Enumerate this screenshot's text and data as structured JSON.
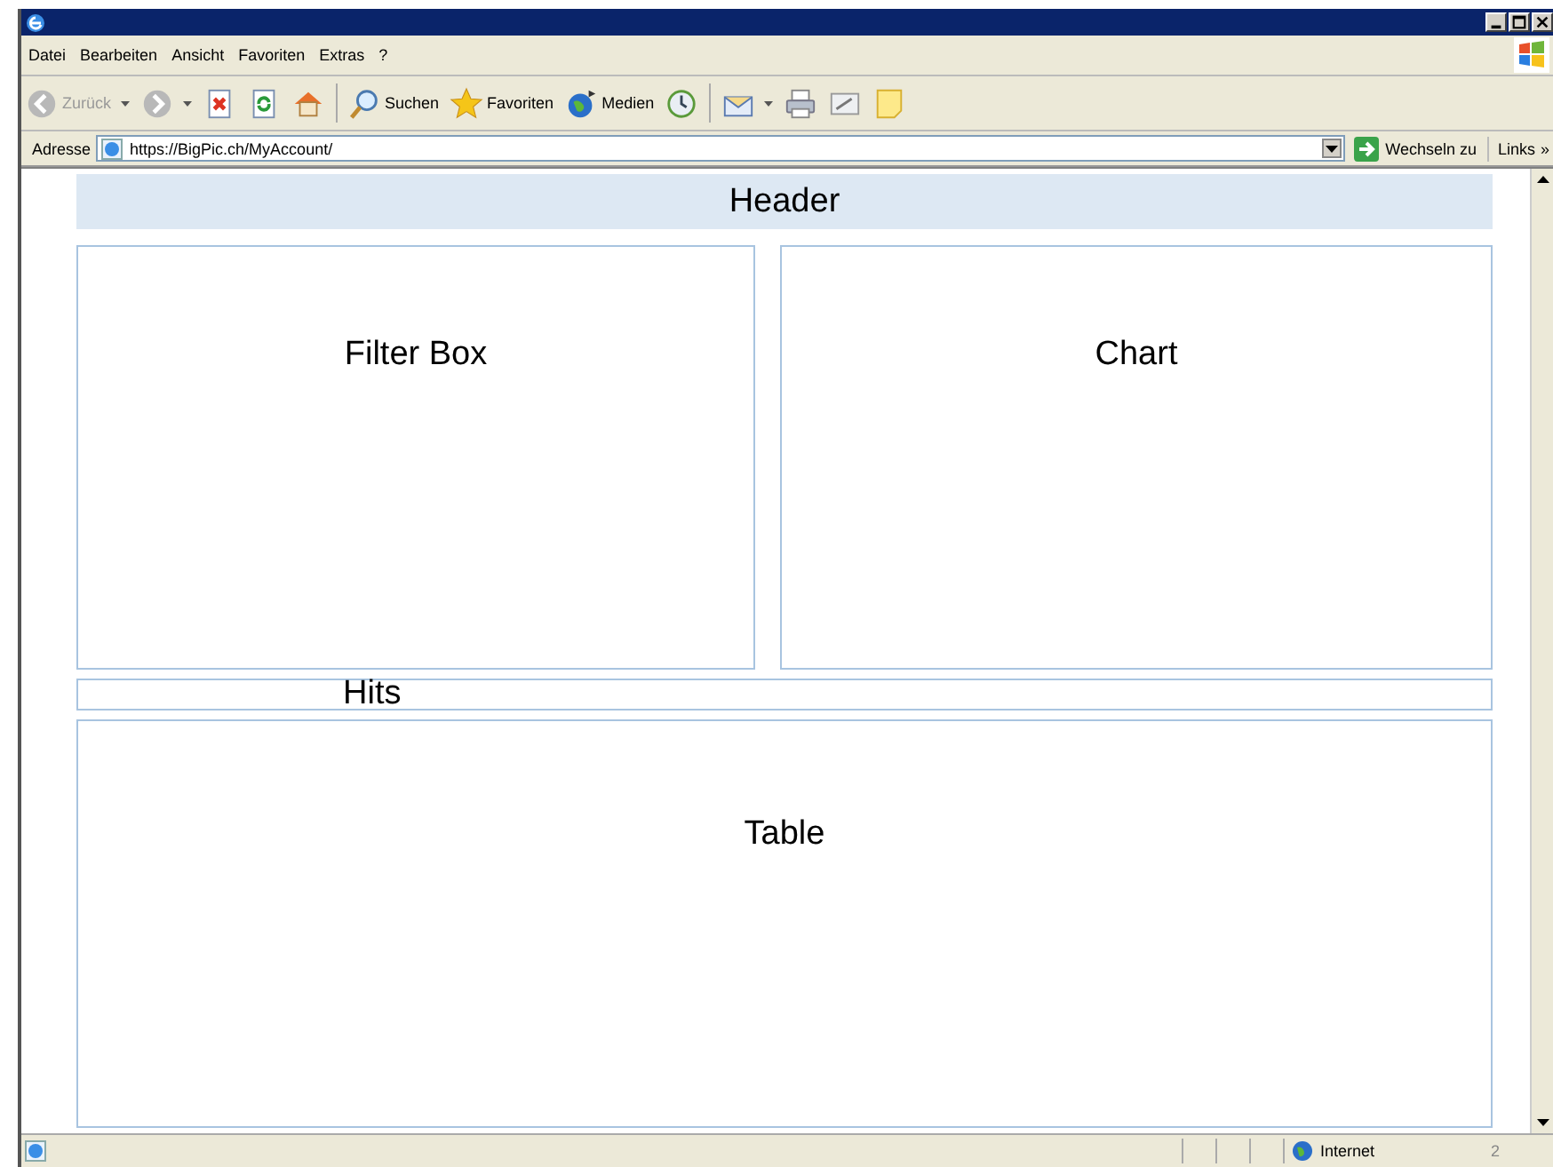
{
  "menu": [
    "Datei",
    "Bearbeiten",
    "Ansicht",
    "Favoriten",
    "Extras",
    "?"
  ],
  "toolbar": [
    {
      "kind": "back",
      "label": "Zurück",
      "disabled": true,
      "caret": true
    },
    {
      "kind": "forward",
      "disabled": true,
      "caret": true
    },
    {
      "kind": "stop"
    },
    {
      "kind": "refresh"
    },
    {
      "kind": "home"
    },
    {
      "kind": "sep"
    },
    {
      "kind": "search",
      "label": "Suchen"
    },
    {
      "kind": "star",
      "label": "Favoriten"
    },
    {
      "kind": "media",
      "label": "Medien"
    },
    {
      "kind": "history"
    },
    {
      "kind": "sep"
    },
    {
      "kind": "mail",
      "caret": true
    },
    {
      "kind": "print"
    },
    {
      "kind": "edit"
    },
    {
      "kind": "note"
    }
  ],
  "address": {
    "label": "Adresse",
    "value": "https://BigPic.ch/MyAccount/",
    "go": "Wechseln zu",
    "links": "Links",
    "more": "»"
  },
  "page": {
    "header": "Header",
    "filter": "Filter Box",
    "chart": "Chart",
    "hits": "Hits",
    "table": "Table"
  },
  "status": {
    "zone": "Internet",
    "count": "2"
  }
}
